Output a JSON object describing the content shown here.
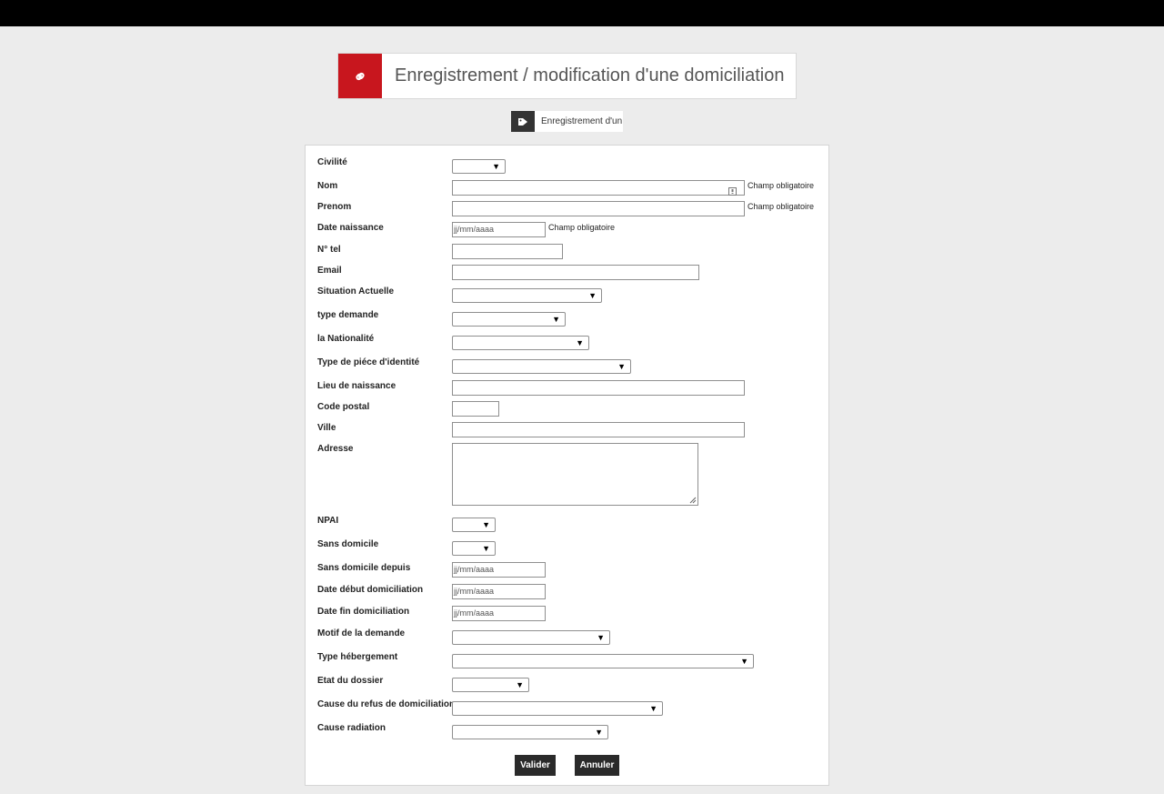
{
  "header": {
    "title": "Enregistrement / modification d'une domiciliation",
    "icon": "link-icon",
    "accent": "#c8161e"
  },
  "tag": {
    "text": "Enregistrement d'un",
    "icon": "tag-icon"
  },
  "form": {
    "required_text": "Champ obligatoire",
    "date_placeholder": "jj/mm/aaaa",
    "labels": {
      "civilite": "Civilité",
      "nom": "Nom",
      "prenom": "Prenom",
      "date_naissance": "Date naissance",
      "tel": "N° tel",
      "email": "Email",
      "situation": "Situation Actuelle",
      "type_demande": "type demande",
      "nationalite": "la Nationalité",
      "piece": "Type de piéce d'identité",
      "lieu_naissance": "Lieu de naissance",
      "code_postal": "Code postal",
      "ville": "Ville",
      "adresse": "Adresse",
      "npai": "NPAI",
      "sans_domicile": "Sans domicile",
      "sans_domicile_depuis": "Sans domicile depuis",
      "date_debut": "Date début domiciliation",
      "date_fin": "Date fin domiciliation",
      "motif": "Motif de la demande",
      "type_hebergement": "Type hébergement",
      "etat": "Etat du dossier",
      "cause_refus": "Cause du refus de domiciliation",
      "cause_radiation": "Cause radiation"
    },
    "values": {
      "civilite": "",
      "nom": "",
      "prenom": "",
      "tel": "",
      "email": "",
      "situation": "",
      "type_demande": "",
      "nationalite": "",
      "piece": "",
      "lieu_naissance": "",
      "code_postal": "",
      "ville": "",
      "adresse": "",
      "npai": "",
      "sans_domicile": "",
      "motif": "",
      "type_hebergement": "",
      "etat": "",
      "cause_refus": "",
      "cause_radiation": ""
    }
  },
  "buttons": {
    "valider": "Valider",
    "annuler": "Annuler"
  }
}
